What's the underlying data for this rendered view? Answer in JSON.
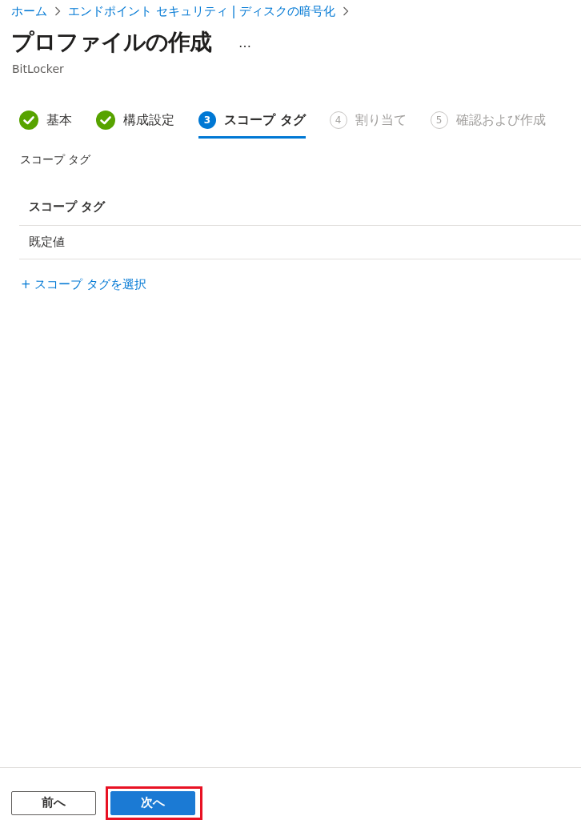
{
  "breadcrumb": [
    "ホーム",
    "エンドポイント セキュリティ | ディスクの暗号化"
  ],
  "title": "プロファイルの作成",
  "more": "…",
  "subtitle": "BitLocker",
  "steps": [
    {
      "label": "基本",
      "completed": true,
      "selected": false
    },
    {
      "label": "構成設定",
      "completed": true,
      "selected": false
    },
    {
      "number": "3",
      "label": "スコープ タグ",
      "completed": false,
      "selected": true
    },
    {
      "number": "4",
      "label": "割り当て",
      "completed": false,
      "selected": false
    },
    {
      "number": "5",
      "label": "確認および作成",
      "completed": false,
      "selected": false
    }
  ],
  "section_label": "スコープ タグ",
  "table": {
    "columns": [
      "スコープ タグ"
    ],
    "rows": [
      [
        "既定値"
      ]
    ]
  },
  "add_link": "+ スコープ タグを選択",
  "buttons": [
    {
      "label": "前へ",
      "kind": "secondary",
      "highlighted": false
    },
    {
      "label": "次へ",
      "kind": "primary",
      "highlighted": true
    }
  ]
}
